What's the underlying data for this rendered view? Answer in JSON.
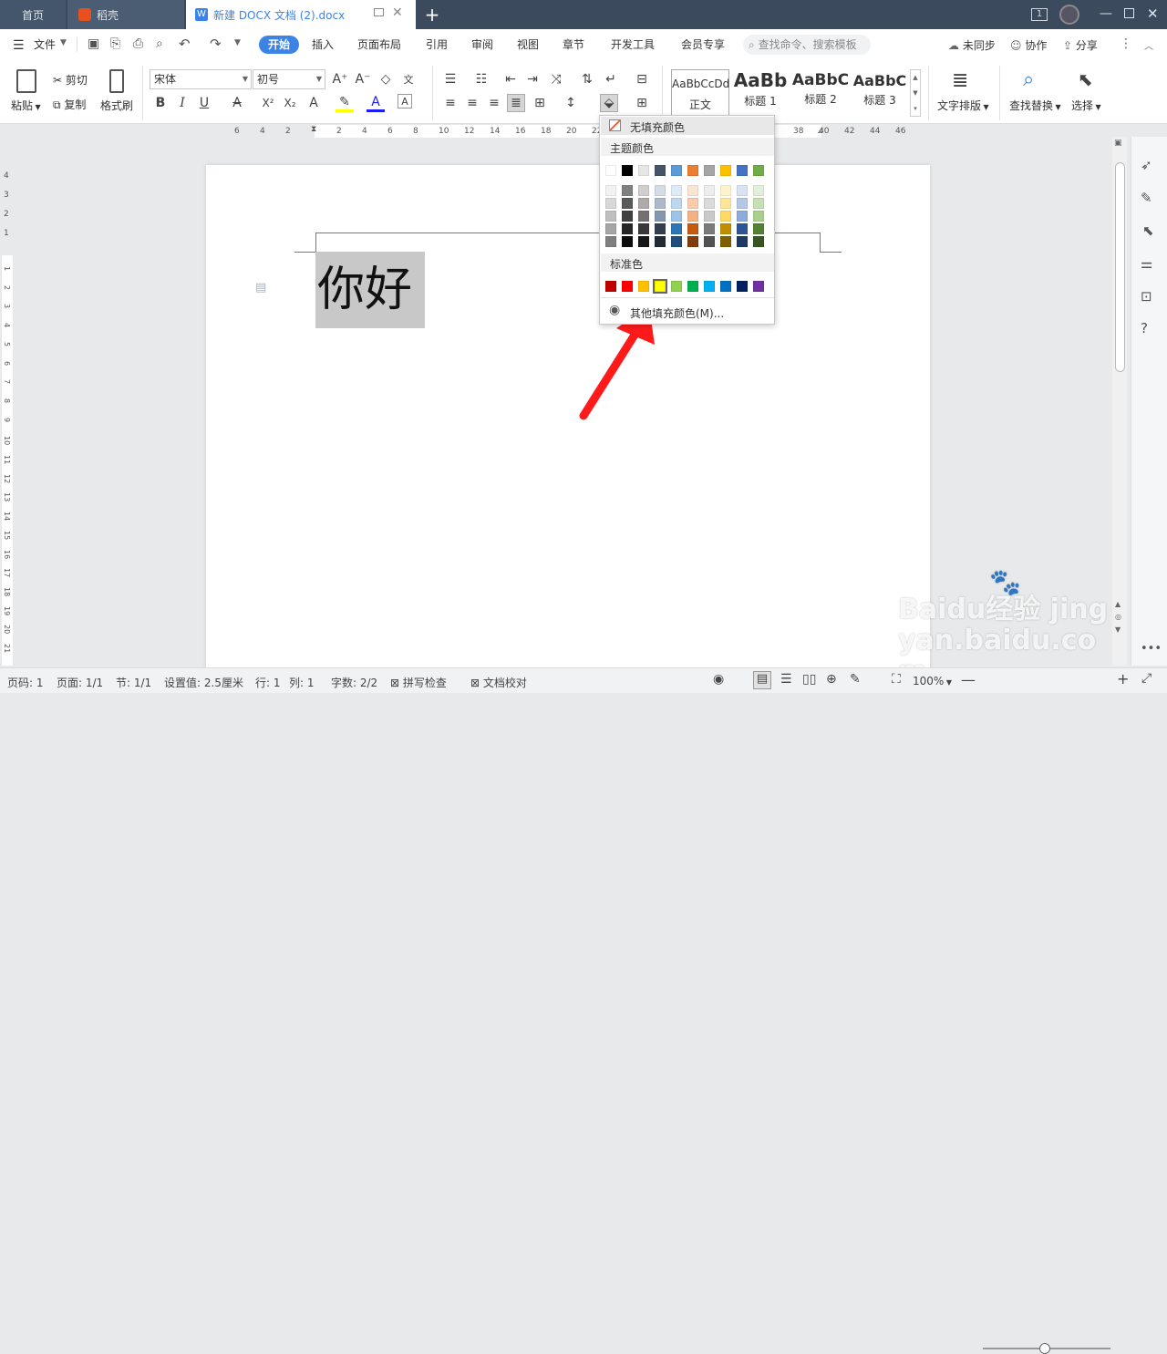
{
  "tabs": {
    "home": "首页",
    "daoke": "稻壳",
    "doc": "新建 DOCX 文档 (2).docx",
    "add": "+",
    "badge": "1"
  },
  "menu": {
    "file": "文件",
    "items": [
      "开始",
      "插入",
      "页面布局",
      "引用",
      "审阅",
      "视图",
      "章节",
      "开发工具",
      "会员专享"
    ],
    "search_placeholder": "查找命令、搜索模板",
    "sync": "未同步",
    "collab": "协作",
    "share": "分享"
  },
  "ribbon": {
    "paste": "粘贴",
    "cut": "剪切",
    "copy": "复制",
    "format_painter": "格式刷",
    "font": "宋体",
    "size": "初号",
    "styles": [
      {
        "preview": "AaBbCcDd",
        "name": "正文"
      },
      {
        "preview": "AaBb",
        "name": "标题 1"
      },
      {
        "preview": "AaBbC",
        "name": "标题 2"
      },
      {
        "preview": "AaBbC",
        "name": "标题 3"
      }
    ],
    "text_layout": "文字排版",
    "find_replace": "查找替换",
    "select": "选择"
  },
  "ruler": {
    "h_left": [
      "6",
      "4",
      "2"
    ],
    "h_marks": [
      "2",
      "4",
      "6",
      "8",
      "10",
      "12",
      "14",
      "16",
      "18",
      "20",
      "22"
    ],
    "h_right": [
      "38",
      "40",
      "42",
      "44",
      "46"
    ],
    "v_top": [
      "4",
      "3",
      "2",
      "1"
    ],
    "v_marks": [
      "1",
      "2",
      "3",
      "4",
      "5",
      "6",
      "7",
      "8",
      "9",
      "10",
      "11",
      "12",
      "13",
      "14",
      "15",
      "16",
      "17",
      "18",
      "19",
      "20",
      "21"
    ]
  },
  "document": {
    "text": "你好"
  },
  "popup": {
    "no_fill": "无填充颜色",
    "theme_title": "主题颜色",
    "theme_row": [
      "#ffffff",
      "#000000",
      "#e7e6e6",
      "#44546a",
      "#5b9bd5",
      "#ed7d31",
      "#a5a5a5",
      "#ffc000",
      "#4472c4",
      "#70ad47"
    ],
    "theme_shades": [
      [
        "#f2f2f2",
        "#7f7f7f",
        "#d0cece",
        "#d6dce4",
        "#deebf6",
        "#fbe5d5",
        "#ededed",
        "#fff2cc",
        "#dae3f3",
        "#e2efda"
      ],
      [
        "#d8d8d8",
        "#595959",
        "#aeaaaa",
        "#adb9ca",
        "#bdd7ee",
        "#f7cbac",
        "#dbdbdb",
        "#fee599",
        "#b4c7e7",
        "#c5e0b3"
      ],
      [
        "#bfbfbf",
        "#3f3f3f",
        "#757070",
        "#8496b0",
        "#9dc3e6",
        "#f4b183",
        "#c9c9c9",
        "#ffd966",
        "#8faadc",
        "#a8d08d"
      ],
      [
        "#a5a5a5",
        "#262626",
        "#3a3838",
        "#323f4f",
        "#2e75b5",
        "#c55a11",
        "#7b7b7b",
        "#bf8f00",
        "#2f5496",
        "#538135"
      ],
      [
        "#7f7f7f",
        "#0c0c0c",
        "#171616",
        "#222a35",
        "#1e4e79",
        "#833c0b",
        "#525252",
        "#7f6000",
        "#1f3864",
        "#375623"
      ]
    ],
    "standard_title": "标准色",
    "standard": [
      "#c00000",
      "#ff0000",
      "#ffc000",
      "#ffff00",
      "#92d050",
      "#00b050",
      "#00b0f0",
      "#0070c0",
      "#002060",
      "#7030a0"
    ],
    "more": "其他填充颜色(M)..."
  },
  "status": {
    "page_num": "页码: 1",
    "pages": "页面: 1/1",
    "section": "节: 1/1",
    "setting": "设置值: 2.5厘米",
    "row": "行: 1",
    "col": "列: 1",
    "words": "字数: 2/2",
    "spell": "拼写检查",
    "proof": "文档校对",
    "zoom": "100%"
  },
  "watermark": "Baidu经验 jingyan.baidu.com"
}
